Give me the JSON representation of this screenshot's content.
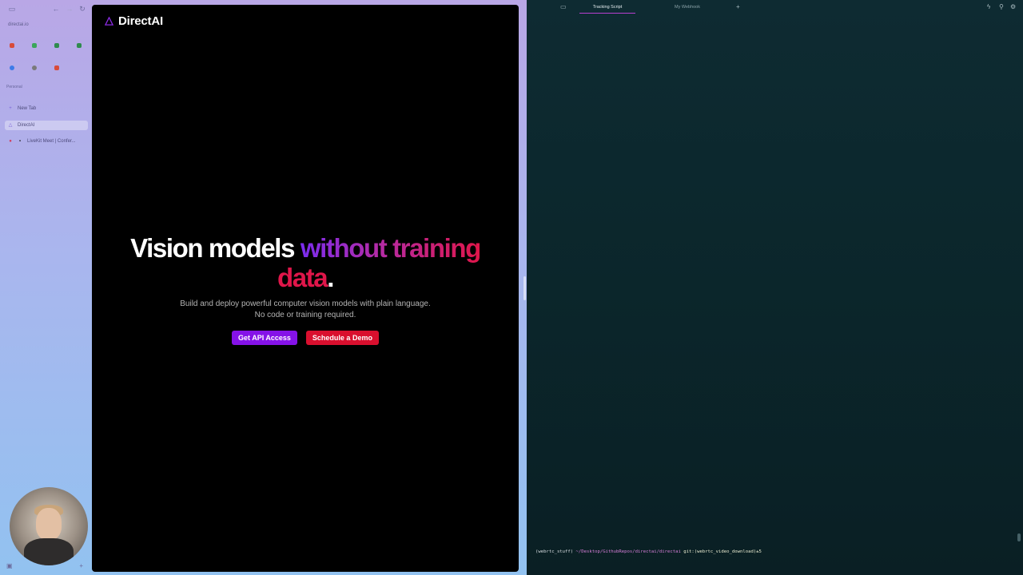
{
  "sidebar": {
    "url": "directai.io",
    "section_label": "Personal",
    "pins": [
      {
        "icon": "gmail-icon",
        "color": "#d84b3a"
      },
      {
        "icon": "drive-icon",
        "color": "#3aa65b"
      },
      {
        "icon": "sheets-icon",
        "color": "#2f8b4d"
      },
      {
        "icon": "meet-icon",
        "color": "#2f8b4d"
      },
      {
        "icon": "figma-icon",
        "color": "#3d7be8"
      },
      {
        "icon": "chrome-icon",
        "color": "#7a7a7a"
      },
      {
        "icon": "gmail-icon-2",
        "color": "#d84b3a"
      }
    ],
    "tabs": [
      {
        "label": "New Tab",
        "icon": "+"
      },
      {
        "label": "DirectAI",
        "icon": "△"
      },
      {
        "label": "LiveKit Meet | Confer...",
        "icon": "▪"
      }
    ]
  },
  "page": {
    "brand": "DirectAI",
    "headline_white": "Vision models ",
    "headline_gradient": "without training",
    "headline_gradient_2": "data",
    "headline_dot": ".",
    "subtitle_line1": "Build and deploy powerful computer vision models with plain language.",
    "subtitle_line2": "No code or training required.",
    "cta_primary": "Get API Access",
    "cta_secondary": "Schedule a Demo",
    "colors": {
      "primary": "#8512e8",
      "secondary": "#d90f2e"
    }
  },
  "terminal": {
    "tabs": [
      "Tracking Script",
      "My Webhook"
    ],
    "active_tab": "Tracking Script",
    "prompt_env": "(webrtc_stuff)",
    "prompt_path": "~/Desktop/GithubRepos/directai/directai",
    "prompt_git": "git:(webrtc_video_download)±5"
  }
}
